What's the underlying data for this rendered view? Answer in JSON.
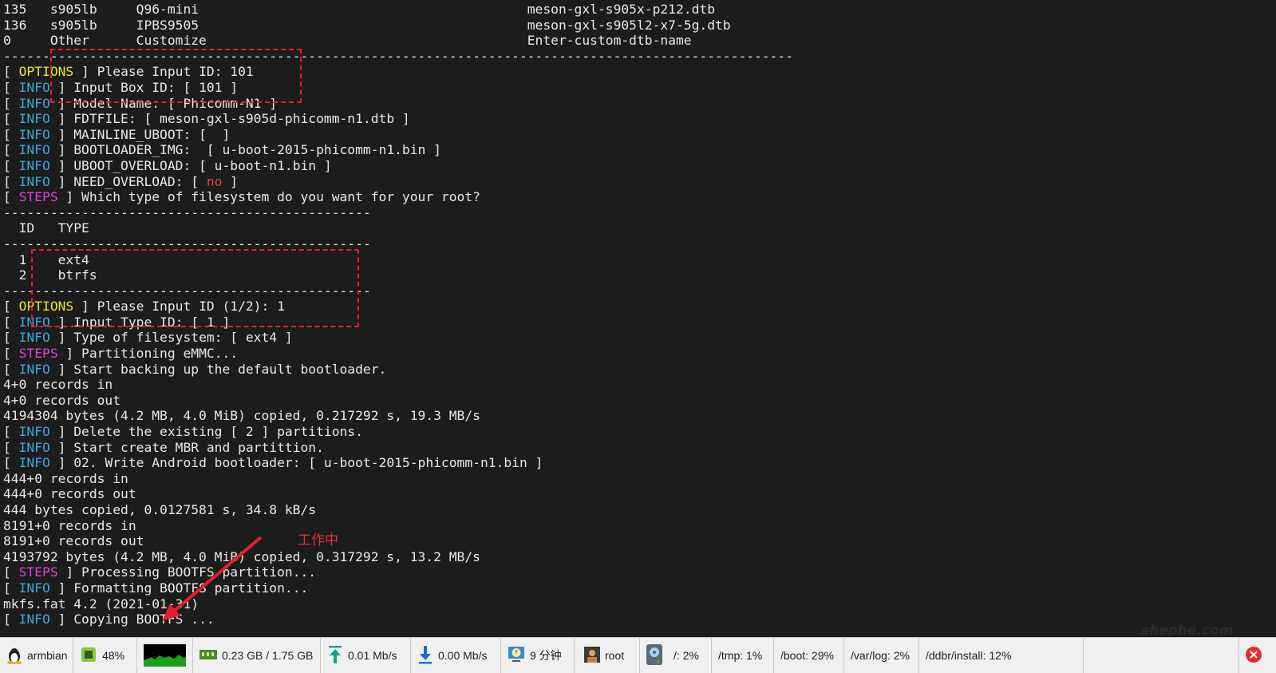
{
  "terminal": {
    "lines": [
      [
        {
          "t": "135   s905lb     Q96-mini                                          meson-gxl-s905x-p212.dtb"
        }
      ],
      [
        {
          "t": "136   s905lb     IPBS9505                                          meson-gxl-s905l2-x7-5g.dtb"
        }
      ],
      [
        {
          "t": "0     Other      Customize                                         Enter-custom-dtb-name"
        }
      ],
      [
        {
          "t": "-----------------------------------------------------------------------------------------------------"
        }
      ],
      [
        {
          "t": "[ "
        },
        {
          "t": "OPTIONS",
          "c": "options"
        },
        {
          "t": " ] Please Input ID: 101"
        }
      ],
      [
        {
          "t": "[ "
        },
        {
          "t": "INFO",
          "c": "info"
        },
        {
          "t": " ] Input Box ID: [ 101 ]"
        }
      ],
      [
        {
          "t": "[ "
        },
        {
          "t": "INFO",
          "c": "info"
        },
        {
          "t": " ] Model Name: [ Phicomm-N1 ]"
        }
      ],
      [
        {
          "t": "[ "
        },
        {
          "t": "INFO",
          "c": "info"
        },
        {
          "t": " ] FDTFILE: [ meson-gxl-s905d-phicomm-n1.dtb ]"
        }
      ],
      [
        {
          "t": "[ "
        },
        {
          "t": "INFO",
          "c": "info"
        },
        {
          "t": " ] MAINLINE_UBOOT: [  ]"
        }
      ],
      [
        {
          "t": "[ "
        },
        {
          "t": "INFO",
          "c": "info"
        },
        {
          "t": " ] BOOTLOADER_IMG:  [ u-boot-2015-phicomm-n1.bin ]"
        }
      ],
      [
        {
          "t": "[ "
        },
        {
          "t": "INFO",
          "c": "info"
        },
        {
          "t": " ] UBOOT_OVERLOAD: [ u-boot-n1.bin ]"
        }
      ],
      [
        {
          "t": "[ "
        },
        {
          "t": "INFO",
          "c": "info"
        },
        {
          "t": " ] NEED_OVERLOAD: [ "
        },
        {
          "t": "no",
          "c": "red"
        },
        {
          "t": " ]"
        }
      ],
      [
        {
          "t": "[ "
        },
        {
          "t": "STEPS",
          "c": "steps"
        },
        {
          "t": " ] Which type of filesystem do you want for your root?"
        }
      ],
      [
        {
          "t": "-----------------------------------------------"
        }
      ],
      [
        {
          "t": "  ID   TYPE"
        }
      ],
      [
        {
          "t": "-----------------------------------------------"
        }
      ],
      [
        {
          "t": "  1    ext4"
        }
      ],
      [
        {
          "t": "  2    btrfs"
        }
      ],
      [
        {
          "t": "-----------------------------------------------"
        }
      ],
      [
        {
          "t": "[ "
        },
        {
          "t": "OPTIONS",
          "c": "options"
        },
        {
          "t": " ] Please Input ID (1/2): 1"
        }
      ],
      [
        {
          "t": "[ "
        },
        {
          "t": "INFO",
          "c": "info"
        },
        {
          "t": " ] Input Type ID: [ 1 ]"
        }
      ],
      [
        {
          "t": "[ "
        },
        {
          "t": "INFO",
          "c": "info"
        },
        {
          "t": " ] Type of filesystem: [ ext4 ]"
        }
      ],
      [
        {
          "t": "[ "
        },
        {
          "t": "STEPS",
          "c": "steps"
        },
        {
          "t": " ] Partitioning eMMC..."
        }
      ],
      [
        {
          "t": "[ "
        },
        {
          "t": "INFO",
          "c": "info"
        },
        {
          "t": " ] Start backing up the default bootloader."
        }
      ],
      [
        {
          "t": "4+0 records in"
        }
      ],
      [
        {
          "t": "4+0 records out"
        }
      ],
      [
        {
          "t": "4194304 bytes (4.2 MB, 4.0 MiB) copied, 0.217292 s, 19.3 MB/s"
        }
      ],
      [
        {
          "t": "[ "
        },
        {
          "t": "INFO",
          "c": "info"
        },
        {
          "t": " ] Delete the existing [ 2 ] partitions."
        }
      ],
      [
        {
          "t": "[ "
        },
        {
          "t": "INFO",
          "c": "info"
        },
        {
          "t": " ] Start create MBR and partittion."
        }
      ],
      [
        {
          "t": "[ "
        },
        {
          "t": "INFO",
          "c": "info"
        },
        {
          "t": " ] 02. Write Android bootloader: [ u-boot-2015-phicomm-n1.bin ]"
        }
      ],
      [
        {
          "t": "444+0 records in"
        }
      ],
      [
        {
          "t": "444+0 records out"
        }
      ],
      [
        {
          "t": "444 bytes copied, 0.0127581 s, 34.8 kB/s"
        }
      ],
      [
        {
          "t": "8191+0 records in"
        }
      ],
      [
        {
          "t": "8191+0 records out"
        }
      ],
      [
        {
          "t": "4193792 bytes (4.2 MB, 4.0 MiB) copied, 0.317292 s, 13.2 MB/s"
        }
      ],
      [
        {
          "t": "[ "
        },
        {
          "t": "STEPS",
          "c": "steps"
        },
        {
          "t": " ] Processing BOOTFS partition..."
        }
      ],
      [
        {
          "t": "[ "
        },
        {
          "t": "INFO",
          "c": "info"
        },
        {
          "t": " ] Formatting BOOTFS partition..."
        }
      ],
      [
        {
          "t": "mkfs.fat 4.2 (2021-01-31)"
        }
      ],
      [
        {
          "t": "[ "
        },
        {
          "t": "INFO",
          "c": "info"
        },
        {
          "t": " ] Copying BOOTFS ..."
        }
      ]
    ]
  },
  "annotation": {
    "label": "工作中",
    "color": "#e0202a"
  },
  "watermark": "shephe.com",
  "statusbar": {
    "host": "armbian",
    "cpu": "48%",
    "memory": "0.23 GB / 1.75 GB",
    "upload": "0.01 Mb/s",
    "download": "0.00 Mb/s",
    "uptime": "9 分钟",
    "user": "root",
    "disk_root": "/: 2%",
    "disk_tmp": "/tmp: 1%",
    "disk_boot": "/boot: 29%",
    "disk_varlog": "/var/log: 2%",
    "disk_install": "/ddbr/install: 12%"
  }
}
